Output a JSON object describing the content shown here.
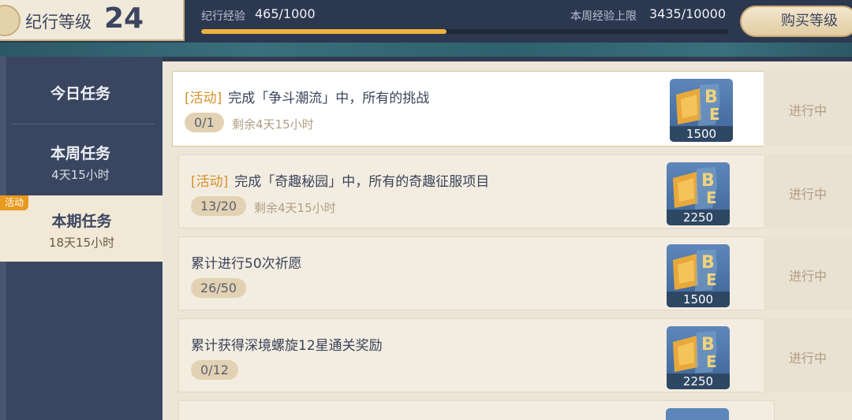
{
  "header": {
    "level_label": "纪行等级",
    "level_value": "24",
    "exp_label": "纪行经验",
    "exp_value": "465/1000",
    "exp_progress": 0.465,
    "weekly_label": "本周经验上限",
    "weekly_value": "3435/10000",
    "buy_button": "购买等级"
  },
  "sidebar": {
    "tabs": [
      {
        "label": "今日任务",
        "sub": ""
      },
      {
        "label": "本周任务",
        "sub": "4天15小时"
      },
      {
        "label": "本期任务",
        "sub": "18天15小时",
        "badge": "活动",
        "selected": true
      }
    ]
  },
  "tasks": [
    {
      "tag": "[活动]",
      "title": "完成「争斗潮流」中，所有的挑战",
      "progress": "0/1",
      "remaining": "剩余4天15小时",
      "reward_amount": "1500",
      "status": "进行中"
    },
    {
      "tag": "[活动]",
      "title": "完成「奇趣秘园」中，所有的奇趣征服项目",
      "progress": "13/20",
      "remaining": "剩余4天15小时",
      "reward_amount": "2250",
      "status": "进行中"
    },
    {
      "tag": "",
      "title": "累计进行50次祈愿",
      "progress": "26/50",
      "remaining": "",
      "reward_amount": "1500",
      "status": "进行中"
    },
    {
      "tag": "",
      "title": "累计获得深境螺旋12星通关奖励",
      "progress": "0/12",
      "remaining": "",
      "reward_amount": "2250",
      "status": "进行中"
    }
  ],
  "colors": {
    "accent": "#f0b23c",
    "tag": "#d6912a",
    "sidebar": "#3a4660"
  }
}
